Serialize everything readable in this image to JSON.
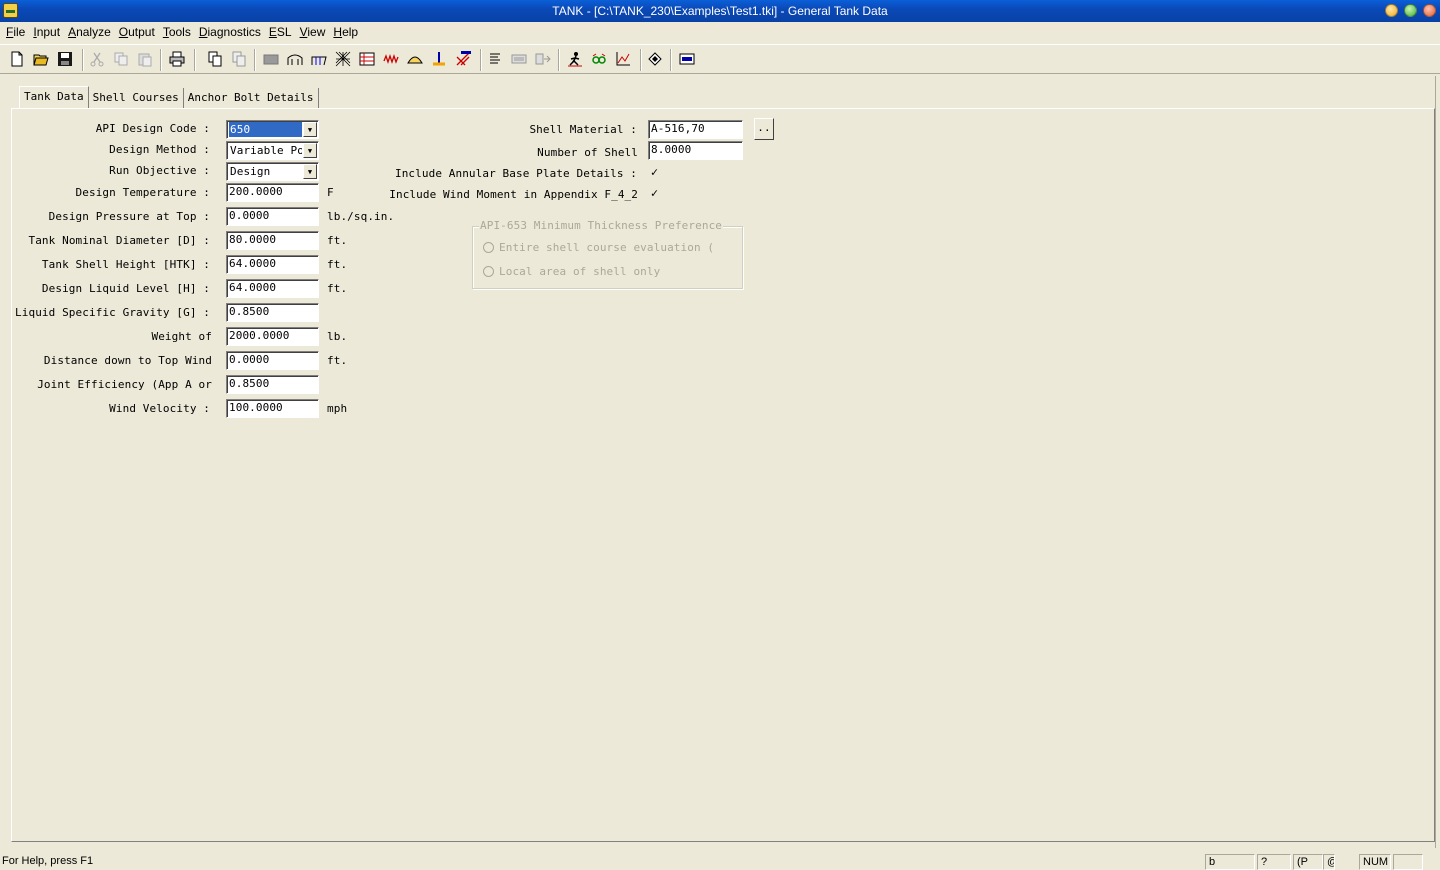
{
  "window": {
    "title": "TANK - [C:\\TANK_230\\Examples\\Test1.tki] - General Tank Data"
  },
  "menu": [
    "File",
    "Input",
    "Analyze",
    "Output",
    "Tools",
    "Diagnostics",
    "ESL",
    "View",
    "Help"
  ],
  "tabs": [
    "Tank Data",
    "Shell Courses",
    "Anchor Bolt Details"
  ],
  "form": {
    "api_design_code": {
      "label": "API Design Code  :",
      "value": "650"
    },
    "design_method": {
      "label": "Design Method  :",
      "value": "Variable Poi:"
    },
    "run_objective": {
      "label": "Run Objective  :",
      "value": "Design"
    },
    "design_temperature": {
      "label": "Design Temperature  :",
      "value": "200.0000",
      "unit": "F"
    },
    "design_pressure": {
      "label": "Design Pressure at Top  :",
      "value": "0.0000",
      "unit": "lb./sq.in."
    },
    "tank_nominal_diameter": {
      "label": "Tank Nominal Diameter [D]  :",
      "value": "80.0000",
      "unit": "ft."
    },
    "tank_shell_height": {
      "label": "Tank Shell Height [HTK]  :",
      "value": "64.0000",
      "unit": "ft."
    },
    "design_liquid_level": {
      "label": "Design Liquid Level [H]  :",
      "value": "64.0000",
      "unit": "ft."
    },
    "liquid_specific_gravity": {
      "label": "Liquid Specific Gravity [G]  :",
      "value": "0.8500"
    },
    "weight_of": {
      "label": "Weight of",
      "value": "2000.0000",
      "unit": "lb."
    },
    "distance_down": {
      "label": "Distance down to Top Wind",
      "value": "0.0000",
      "unit": "ft."
    },
    "joint_efficiency": {
      "label": "Joint Efficiency (App A or",
      "value": "0.8500"
    },
    "wind_velocity": {
      "label": "Wind Velocity  :",
      "value": "100.0000",
      "unit": "mph"
    },
    "shell_material": {
      "label": "Shell Material  :",
      "value": "A-516,70",
      "button": ".."
    },
    "number_of_shell": {
      "label": "Number of Shell",
      "value": "8.0000"
    },
    "include_annular": {
      "label": "Include Annular Base Plate Details  :",
      "checked": "✓"
    },
    "include_wind_moment": {
      "label": "Include Wind Moment in Appendix F_4_2",
      "checked": "✓"
    },
    "api653_group": {
      "title": "API-653 Minimum Thickness Preference",
      "option1": "Entire shell course evaluation (",
      "option2": "Local area of shell only"
    }
  },
  "status": {
    "help_text": "For Help, press F1",
    "panes": [
      "b",
      "?",
      "(P",
      "@",
      "NUM",
      ""
    ]
  }
}
